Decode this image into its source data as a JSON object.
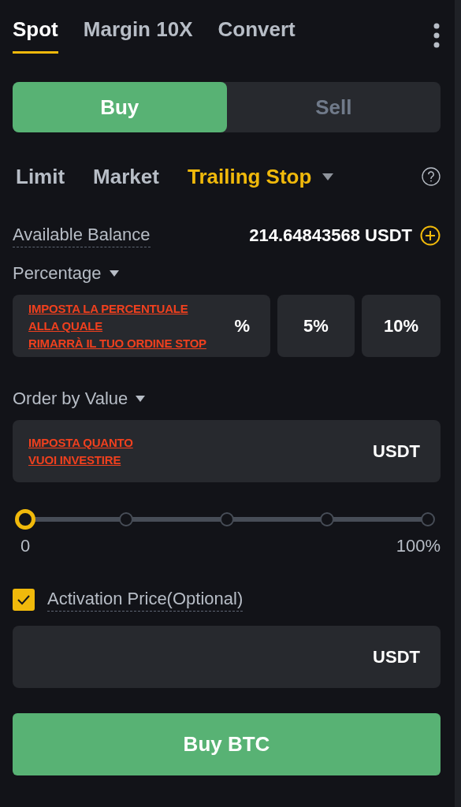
{
  "tabs": [
    {
      "label": "Spot",
      "selected": true
    },
    {
      "label": "Margin 10X",
      "selected": false
    },
    {
      "label": "Convert",
      "selected": false
    }
  ],
  "side_toggle": [
    {
      "label": "Buy",
      "selected": true
    },
    {
      "label": "Sell",
      "selected": false
    }
  ],
  "order_types": [
    {
      "label": "Limit",
      "selected": false,
      "dropdown": false
    },
    {
      "label": "Market",
      "selected": false,
      "dropdown": false
    },
    {
      "label": "Trailing Stop",
      "selected": true,
      "dropdown": true
    }
  ],
  "available_balance": {
    "label": "Available Balance",
    "value": "214.64843568 USDT"
  },
  "percentage": {
    "label": "Percentage",
    "annotation": "IMPOSTA LA PERCENTUALE\nALLA QUALE\nRIMARRÀ IL TUO ORDINE STOP",
    "suffix": "%",
    "presets": [
      "5%",
      "10%"
    ]
  },
  "order_by_value": {
    "label": "Order by Value",
    "annotation": "IMPOSTA QUANTO\nVUOI INVESTIRE",
    "suffix": "USDT"
  },
  "slider": {
    "level": 0,
    "min_label": "0",
    "max_label": "100%"
  },
  "activation_price": {
    "label": "Activation Price(Optional)",
    "checked": true,
    "suffix": "USDT"
  },
  "submit": {
    "label": "Buy BTC"
  }
}
